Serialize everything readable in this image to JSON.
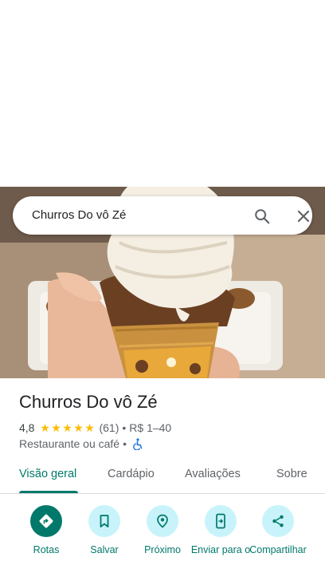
{
  "search": {
    "query": "Churros Do vô Zé"
  },
  "place": {
    "name": "Churros Do vô Zé",
    "rating": "4,8",
    "stars": [
      "★",
      "★",
      "★",
      "★",
      "★"
    ],
    "review_count": "(61)",
    "bullet": "•",
    "price_range": "R$ 1–40",
    "category": "Restaurante ou café",
    "category_bullet": "•"
  },
  "tabs": [
    {
      "label": "Visão geral",
      "active": true
    },
    {
      "label": "Cardápio",
      "active": false
    },
    {
      "label": "Avaliações",
      "active": false
    },
    {
      "label": "Sobre",
      "active": false
    }
  ],
  "actions": [
    {
      "label": "Rotas",
      "icon": "directions-icon"
    },
    {
      "label": "Salvar",
      "icon": "bookmark-icon"
    },
    {
      "label": "Próximo",
      "icon": "nearby-icon"
    },
    {
      "label": "Enviar para o",
      "icon": "send-to-phone-icon"
    },
    {
      "label": "Compartilhar",
      "icon": "share-icon"
    }
  ],
  "colors": {
    "accent": "#00796b",
    "action_bg": "#c8f3fb",
    "star": "#fbbc04",
    "accessibility_icon": "#1a73e8"
  }
}
